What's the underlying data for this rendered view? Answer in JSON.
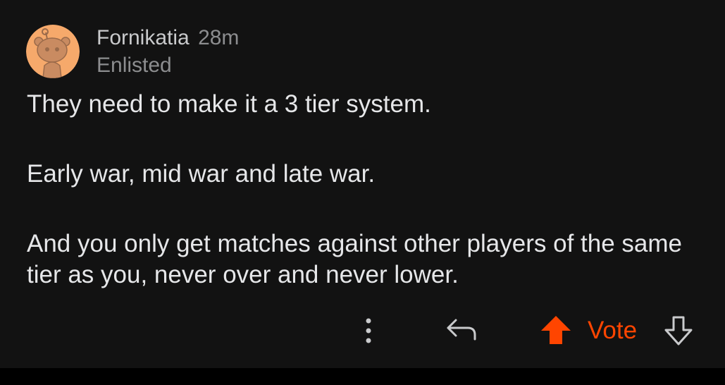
{
  "comment": {
    "author": "Fornikatia",
    "age": "28m",
    "flair": "Enlisted",
    "paragraphs": [
      "They need to make it a 3 tier system.",
      "Early war, mid war and late war.",
      "And you only get matches against other players of the same tier as you, never over and never lower."
    ]
  },
  "actions": {
    "more_icon": "vertical-ellipsis",
    "reply_icon": "reply-arrow",
    "upvote_icon": "arrow-up-filled",
    "vote_label": "Vote",
    "downvote_icon": "arrow-down-outline"
  },
  "colors": {
    "background": "#121212",
    "accent": "#ff4500",
    "avatar_background": "#f6a96b",
    "text_primary": "#e6e7e9",
    "text_secondary": "#8c8d8f"
  }
}
